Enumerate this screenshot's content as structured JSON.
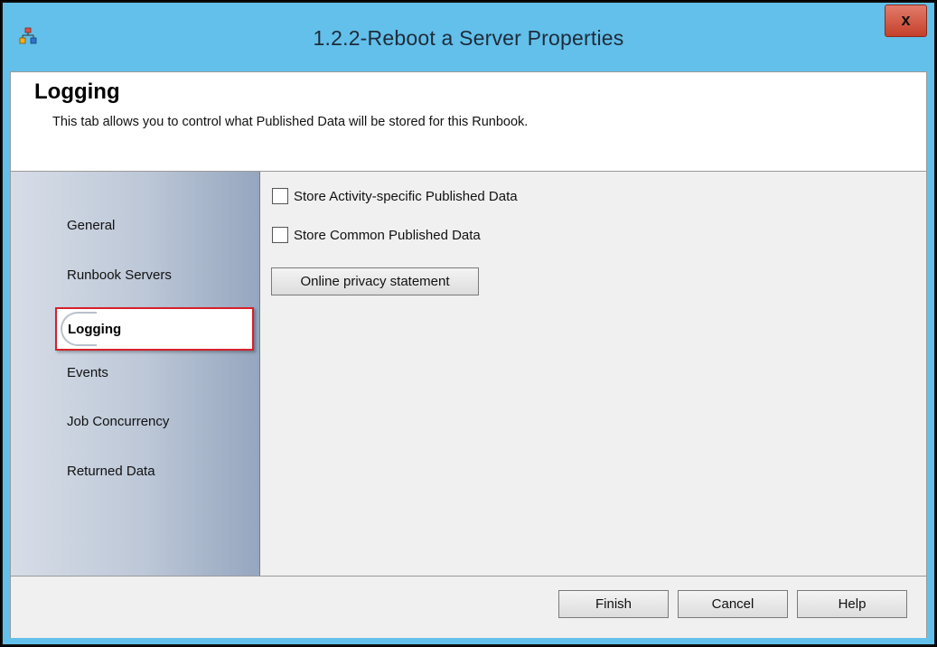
{
  "window": {
    "title": "1.2.2-Reboot a Server Properties",
    "close_label": "x",
    "accent_color": "#62c0ea"
  },
  "header": {
    "title": "Logging",
    "description": "This tab allows you to control what Published Data will be stored for this Runbook."
  },
  "sidebar": {
    "items": [
      {
        "label": "General"
      },
      {
        "label": "Runbook Servers"
      },
      {
        "label": "Logging"
      },
      {
        "label": "Events"
      },
      {
        "label": "Job Concurrency"
      },
      {
        "label": "Returned Data"
      }
    ],
    "selected_index": 2,
    "highlight_color": "#d7202a"
  },
  "content": {
    "checkboxes": [
      {
        "label": "Store Activity-specific Published Data",
        "checked": false
      },
      {
        "label": "Store Common Published Data",
        "checked": false
      }
    ],
    "privacy_button": "Online privacy statement"
  },
  "footer": {
    "finish": "Finish",
    "cancel": "Cancel",
    "help": "Help"
  }
}
